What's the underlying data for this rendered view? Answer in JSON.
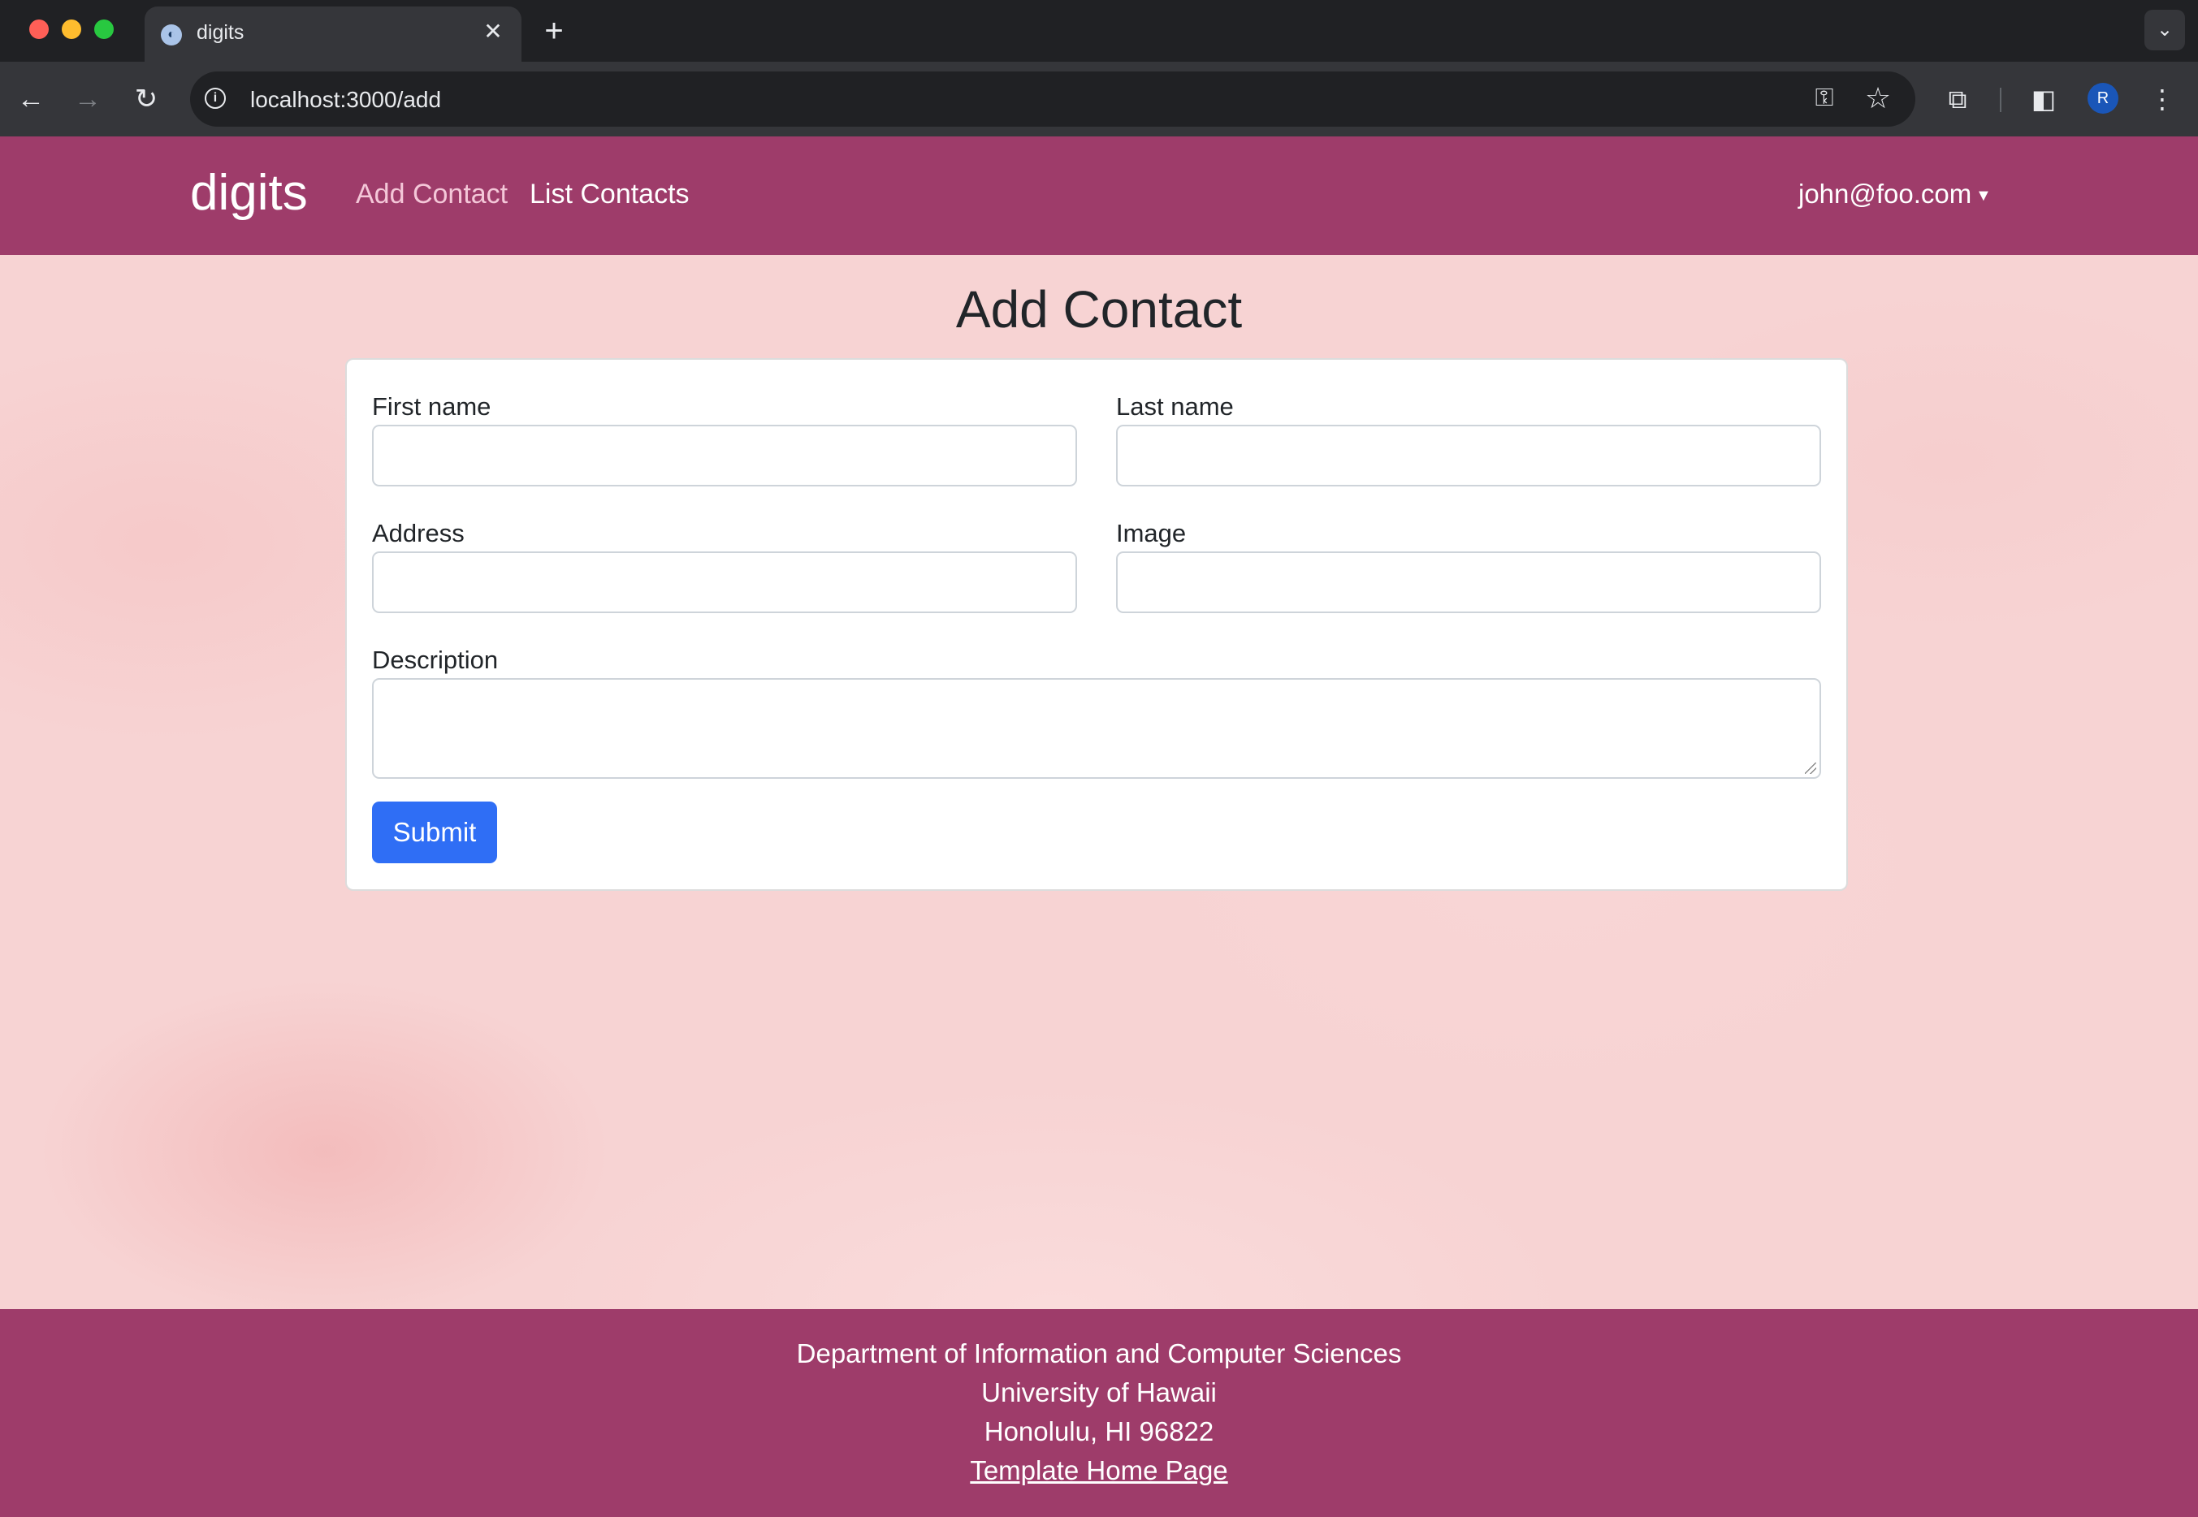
{
  "browser": {
    "tab_title": "digits",
    "tab_close": "✕",
    "new_tab": "+",
    "url": "localhost:3000/add",
    "avatar_initial": "R"
  },
  "navbar": {
    "brand": "digits",
    "links": [
      {
        "label": "Add Contact",
        "active": true
      },
      {
        "label": "List Contacts",
        "active": false
      }
    ],
    "user": "john@foo.com"
  },
  "page": {
    "title": "Add Contact"
  },
  "form": {
    "first_name": {
      "label": "First name",
      "value": ""
    },
    "last_name": {
      "label": "Last name",
      "value": ""
    },
    "address": {
      "label": "Address",
      "value": ""
    },
    "image": {
      "label": "Image",
      "value": ""
    },
    "description": {
      "label": "Description",
      "value": ""
    },
    "submit_label": "Submit"
  },
  "footer": {
    "lines": [
      "Department of Information and Computer Sciences",
      "University of Hawaii",
      "Honolulu, HI 96822"
    ],
    "link_label": "Template Home Page"
  },
  "colors": {
    "navbar": "#9e3c6a",
    "page_background": "#f7d3d3",
    "submit_button": "#2f6ef5"
  },
  "icons": {
    "back": "arrow-left-icon",
    "forward": "arrow-right-icon",
    "reload": "reload-icon",
    "site_info": "info-icon",
    "password_key": "key-icon",
    "bookmark": "star-icon",
    "extensions": "puzzle-icon",
    "side_panel": "side-panel-icon",
    "menu": "more-vertical-icon",
    "tab_list": "chevron-down-icon",
    "user_dropdown": "caret-down-icon"
  }
}
